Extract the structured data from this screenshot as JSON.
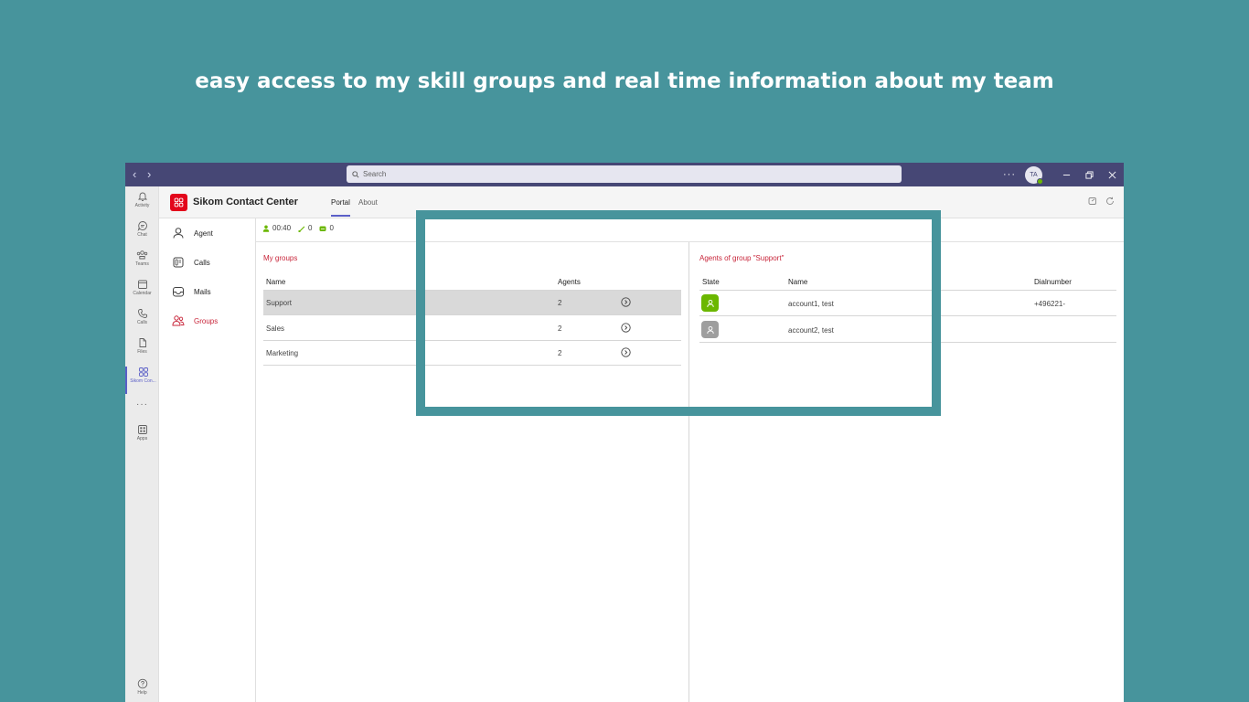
{
  "headline": "easy access to my skill groups and real time information about my team",
  "colors": {
    "background": "#47949c",
    "titlebar": "#464775",
    "brand": "#e3061b",
    "accent_red": "#c8253a",
    "available": "#6bb700",
    "offline": "#9e9e9e"
  },
  "titlebar": {
    "search_placeholder": "Search",
    "more": "···",
    "avatar_initials": "TA"
  },
  "rail": {
    "items": [
      {
        "label": "Activity",
        "icon": "bell-icon"
      },
      {
        "label": "Chat",
        "icon": "chat-icon"
      },
      {
        "label": "Teams",
        "icon": "teams-icon"
      },
      {
        "label": "Calendar",
        "icon": "calendar-icon"
      },
      {
        "label": "Calls",
        "icon": "phone-icon"
      },
      {
        "label": "Files",
        "icon": "file-icon"
      },
      {
        "label": "Sikom Con...",
        "icon": "app-grid-icon"
      },
      {
        "label": "Apps",
        "icon": "apps-icon"
      },
      {
        "label": "Help",
        "icon": "help-icon"
      }
    ],
    "more": "···"
  },
  "app": {
    "title": "Sikom Contact Center",
    "tabs": [
      "Portal",
      "About"
    ]
  },
  "menu": {
    "items": [
      {
        "label": "Agent",
        "icon": "person-icon"
      },
      {
        "label": "Calls",
        "icon": "calls-icon"
      },
      {
        "label": "Mails",
        "icon": "mail-icon"
      },
      {
        "label": "Groups",
        "icon": "groups-icon"
      }
    ]
  },
  "status": {
    "time": "00:40",
    "calls": "0",
    "mails": "0"
  },
  "my_groups": {
    "title": "My groups",
    "columns": {
      "name": "Name",
      "agents": "Agents"
    },
    "rows": [
      {
        "name": "Support",
        "agents": "2"
      },
      {
        "name": "Sales",
        "agents": "2"
      },
      {
        "name": "Marketing",
        "agents": "2"
      }
    ]
  },
  "group_agents": {
    "title": "Agents of group \"Support\"",
    "columns": {
      "state": "State",
      "name": "Name",
      "dialnumber": "Dialnumber"
    },
    "rows": [
      {
        "state": "available",
        "name": "account1, test",
        "dialnumber": "+496221-"
      },
      {
        "state": "offline",
        "name": "account2, test",
        "dialnumber": ""
      }
    ]
  }
}
